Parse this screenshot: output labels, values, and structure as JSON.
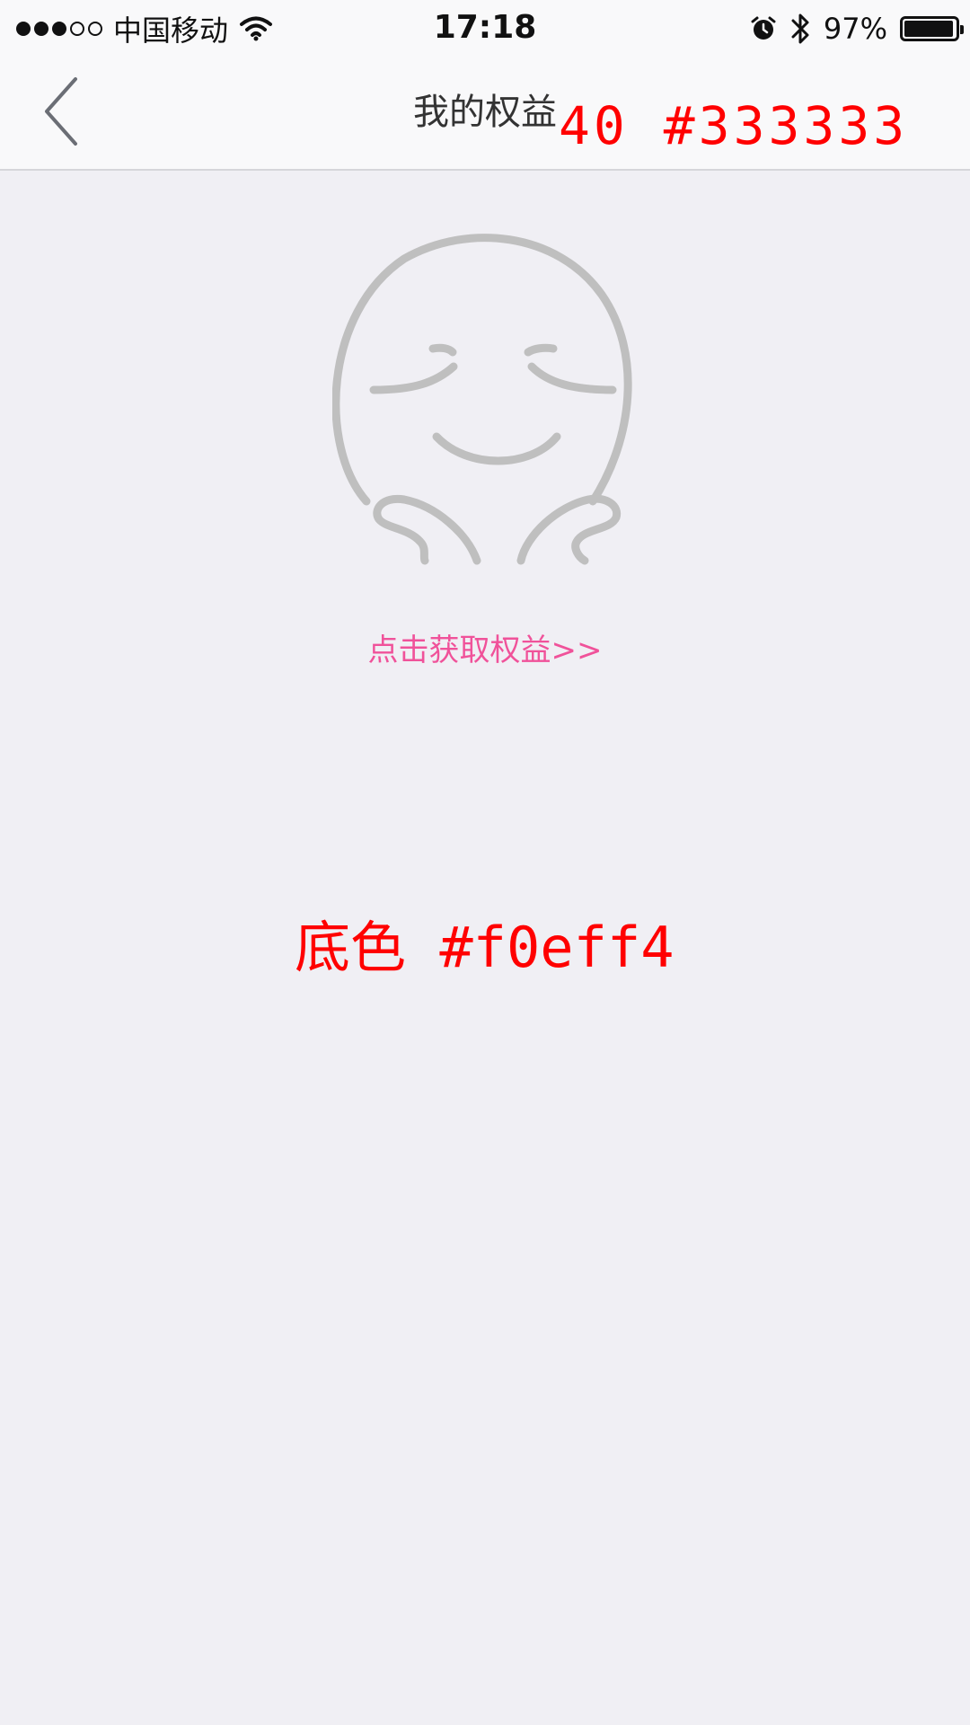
{
  "status_bar": {
    "carrier": "中国移动",
    "time": "17:18",
    "battery_percent": "97%",
    "battery_level": 0.97,
    "signal_bars_filled": 3,
    "signal_bars_total": 5,
    "icons": [
      "wifi-icon",
      "alarm-icon",
      "bluetooth-icon",
      "battery-icon"
    ]
  },
  "nav": {
    "title": "我的权益",
    "back_icon": "chevron-left-icon"
  },
  "empty_state": {
    "mascot_icon": "smiling-face-icon",
    "link_text": "点击获取权益>>"
  },
  "annotations": {
    "title_spec": "40 #333333",
    "background_spec": "底色 #f0eff4"
  },
  "colors": {
    "background": "#f0eff4",
    "title_text": "#333333",
    "link": "#f0529a",
    "annotation": "#ff0000",
    "mascot_stroke": "#bfbfbf"
  }
}
